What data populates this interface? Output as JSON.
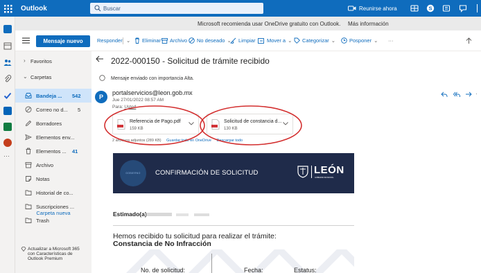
{
  "app": {
    "name": "Outlook"
  },
  "search": {
    "placeholder": "Buscar"
  },
  "topbar": {
    "meet_now": "Reunirse ahora"
  },
  "banner": {
    "text": "Microsoft recomienda usar OneDrive gratuito con Outlook.",
    "link": "Más información"
  },
  "toolbar": {
    "new_mail": "Mensaje nuevo",
    "reply": "Responder",
    "delete": "Eliminar",
    "archive": "Archivo",
    "junk": "No deseado",
    "sweep": "Limpiar",
    "move": "Mover a",
    "categorize": "Categorizar",
    "snooze": "Posponer",
    "more": "···"
  },
  "folders": {
    "favorites": "Favoritos",
    "folders": "Carpetas",
    "items": [
      {
        "label": "Bandeja ...",
        "count": "542",
        "icon": "inbox-icon"
      },
      {
        "label": "Correo no d...",
        "count": "5",
        "icon": "junk-icon"
      },
      {
        "label": "Borradores",
        "count": "",
        "icon": "pencil-icon"
      },
      {
        "label": "Elementos env...",
        "count": "",
        "icon": "send-icon"
      },
      {
        "label": "Elementos ...",
        "count": "41",
        "icon": "trash-icon"
      },
      {
        "label": "Archivo",
        "count": "",
        "icon": "archive-icon"
      },
      {
        "label": "Notas",
        "count": "",
        "icon": "note-icon"
      },
      {
        "label": "Historial de co...",
        "count": "",
        "icon": "folder-icon"
      },
      {
        "label": "Suscripciones ...",
        "count": "",
        "icon": "folder-icon"
      },
      {
        "label": "Trash",
        "count": "",
        "icon": "folder-icon"
      }
    ],
    "new_folder": "Carpeta nueva",
    "upsell": "Actualizar a Microsoft 365 con Características de Outlook Premium"
  },
  "message": {
    "subject": "2022-000150 - Solicitud de trámite recibido",
    "importance": "Mensaje enviado con importancia Alta.",
    "avatar_initial": "P",
    "sender": "portalservicios@leon.gob.mx",
    "date": "Jue 27/01/2022 08:57 AM",
    "to_label": "Para:",
    "to_name": "Usted",
    "attachments": [
      {
        "name": "Referencia de Pago.pdf",
        "size": "159 KB"
      },
      {
        "name": "Solicitud de constancia d...",
        "size": "130 KB"
      }
    ],
    "attach_summary": "2 archivos adjuntos (289 KB)",
    "attach_save": "Guardar todo en OneDrive",
    "attach_download": "Descargar todo"
  },
  "email_body": {
    "circle_text": "GOBIERNO MUNICIPAL",
    "banner_title": "CONFIRMACIÓN DE SOLICITUD",
    "logo_word": "LEÓN",
    "logo_sub": "GOBIERNO MUNICIPAL",
    "greeting": "Estimado(a)",
    "intro": "Hemos recibido tu solicitud para realizar el trámite:",
    "certificate": "Constancia de No Infracción",
    "col_request": "No. de solicitud:",
    "col_date": "Fecha:",
    "col_status": "Estatus:"
  },
  "colors": {
    "brand": "#0f6cbd",
    "folder_pane": "#f3f2f1",
    "email_banner": "#1f2b4a",
    "annotation": "#d32f2f"
  }
}
